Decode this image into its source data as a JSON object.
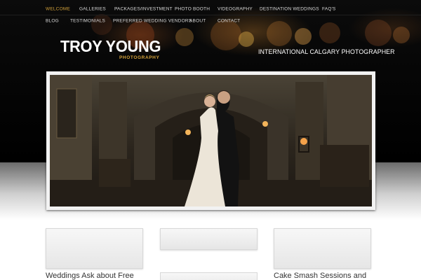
{
  "nav": {
    "row1": [
      {
        "label": "WELCOME",
        "active": true
      },
      {
        "label": "GALLERIES",
        "active": false
      },
      {
        "label": "PACKAGES/INVESTMENT",
        "active": false
      },
      {
        "label": "PHOTO BOOTH",
        "active": false
      },
      {
        "label": "VIDEOGRAPHY",
        "active": false
      },
      {
        "label": "DESTINATION WEDDINGS",
        "active": false
      },
      {
        "label": "FAQ'S",
        "active": false
      }
    ],
    "row2": [
      {
        "label": "BLOG"
      },
      {
        "label": "TESTIMONIALS"
      },
      {
        "label": "PREFERRED WEDDING VENDORS"
      },
      {
        "label": "ABOUT"
      },
      {
        "label": "CONTACT"
      }
    ]
  },
  "brand": {
    "name": "TROY YOUNG",
    "sub": "PHOTOGRAPHY",
    "tagline": "INTERNATIONAL CALGARY PHOTOGRAPHER"
  },
  "hero": {
    "image_icon": "wedding-couple-photo"
  },
  "features": [
    {
      "title": "Weddings  Ask about Free"
    },
    {
      "title": ""
    },
    {
      "title": "Cake Smash Sessions and"
    }
  ],
  "colors": {
    "accent": "#d4a23a",
    "header_bg": "#000000",
    "nav_text": "#dcdcdc",
    "body_text": "#333333"
  }
}
